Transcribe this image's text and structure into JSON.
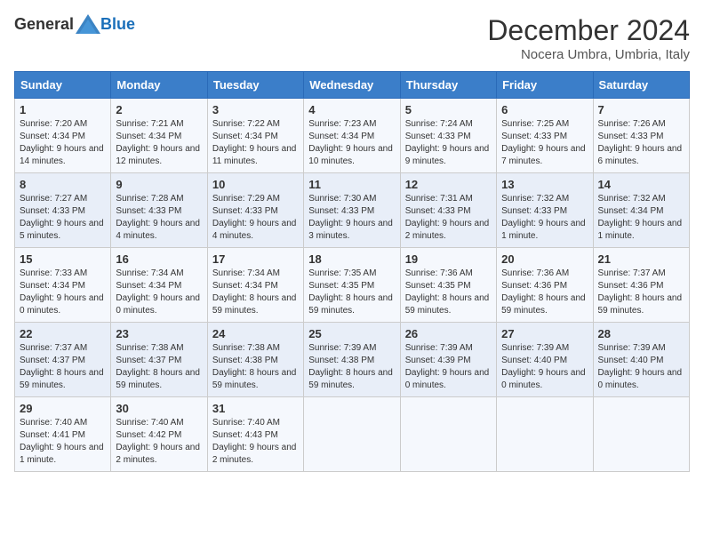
{
  "header": {
    "logo_general": "General",
    "logo_blue": "Blue",
    "month_title": "December 2024",
    "subtitle": "Nocera Umbra, Umbria, Italy"
  },
  "days_of_week": [
    "Sunday",
    "Monday",
    "Tuesday",
    "Wednesday",
    "Thursday",
    "Friday",
    "Saturday"
  ],
  "weeks": [
    [
      {
        "day": "1",
        "sunrise": "7:20 AM",
        "sunset": "4:34 PM",
        "daylight": "9 hours and 14 minutes."
      },
      {
        "day": "2",
        "sunrise": "7:21 AM",
        "sunset": "4:34 PM",
        "daylight": "9 hours and 12 minutes."
      },
      {
        "day": "3",
        "sunrise": "7:22 AM",
        "sunset": "4:34 PM",
        "daylight": "9 hours and 11 minutes."
      },
      {
        "day": "4",
        "sunrise": "7:23 AM",
        "sunset": "4:34 PM",
        "daylight": "9 hours and 10 minutes."
      },
      {
        "day": "5",
        "sunrise": "7:24 AM",
        "sunset": "4:33 PM",
        "daylight": "9 hours and 9 minutes."
      },
      {
        "day": "6",
        "sunrise": "7:25 AM",
        "sunset": "4:33 PM",
        "daylight": "9 hours and 7 minutes."
      },
      {
        "day": "7",
        "sunrise": "7:26 AM",
        "sunset": "4:33 PM",
        "daylight": "9 hours and 6 minutes."
      }
    ],
    [
      {
        "day": "8",
        "sunrise": "7:27 AM",
        "sunset": "4:33 PM",
        "daylight": "9 hours and 5 minutes."
      },
      {
        "day": "9",
        "sunrise": "7:28 AM",
        "sunset": "4:33 PM",
        "daylight": "9 hours and 4 minutes."
      },
      {
        "day": "10",
        "sunrise": "7:29 AM",
        "sunset": "4:33 PM",
        "daylight": "9 hours and 4 minutes."
      },
      {
        "day": "11",
        "sunrise": "7:30 AM",
        "sunset": "4:33 PM",
        "daylight": "9 hours and 3 minutes."
      },
      {
        "day": "12",
        "sunrise": "7:31 AM",
        "sunset": "4:33 PM",
        "daylight": "9 hours and 2 minutes."
      },
      {
        "day": "13",
        "sunrise": "7:32 AM",
        "sunset": "4:33 PM",
        "daylight": "9 hours and 1 minute."
      },
      {
        "day": "14",
        "sunrise": "7:32 AM",
        "sunset": "4:34 PM",
        "daylight": "9 hours and 1 minute."
      }
    ],
    [
      {
        "day": "15",
        "sunrise": "7:33 AM",
        "sunset": "4:34 PM",
        "daylight": "9 hours and 0 minutes."
      },
      {
        "day": "16",
        "sunrise": "7:34 AM",
        "sunset": "4:34 PM",
        "daylight": "9 hours and 0 minutes."
      },
      {
        "day": "17",
        "sunrise": "7:34 AM",
        "sunset": "4:34 PM",
        "daylight": "8 hours and 59 minutes."
      },
      {
        "day": "18",
        "sunrise": "7:35 AM",
        "sunset": "4:35 PM",
        "daylight": "8 hours and 59 minutes."
      },
      {
        "day": "19",
        "sunrise": "7:36 AM",
        "sunset": "4:35 PM",
        "daylight": "8 hours and 59 minutes."
      },
      {
        "day": "20",
        "sunrise": "7:36 AM",
        "sunset": "4:36 PM",
        "daylight": "8 hours and 59 minutes."
      },
      {
        "day": "21",
        "sunrise": "7:37 AM",
        "sunset": "4:36 PM",
        "daylight": "8 hours and 59 minutes."
      }
    ],
    [
      {
        "day": "22",
        "sunrise": "7:37 AM",
        "sunset": "4:37 PM",
        "daylight": "8 hours and 59 minutes."
      },
      {
        "day": "23",
        "sunrise": "7:38 AM",
        "sunset": "4:37 PM",
        "daylight": "8 hours and 59 minutes."
      },
      {
        "day": "24",
        "sunrise": "7:38 AM",
        "sunset": "4:38 PM",
        "daylight": "8 hours and 59 minutes."
      },
      {
        "day": "25",
        "sunrise": "7:39 AM",
        "sunset": "4:38 PM",
        "daylight": "8 hours and 59 minutes."
      },
      {
        "day": "26",
        "sunrise": "7:39 AM",
        "sunset": "4:39 PM",
        "daylight": "9 hours and 0 minutes."
      },
      {
        "day": "27",
        "sunrise": "7:39 AM",
        "sunset": "4:40 PM",
        "daylight": "9 hours and 0 minutes."
      },
      {
        "day": "28",
        "sunrise": "7:39 AM",
        "sunset": "4:40 PM",
        "daylight": "9 hours and 0 minutes."
      }
    ],
    [
      {
        "day": "29",
        "sunrise": "7:40 AM",
        "sunset": "4:41 PM",
        "daylight": "9 hours and 1 minute."
      },
      {
        "day": "30",
        "sunrise": "7:40 AM",
        "sunset": "4:42 PM",
        "daylight": "9 hours and 2 minutes."
      },
      {
        "day": "31",
        "sunrise": "7:40 AM",
        "sunset": "4:43 PM",
        "daylight": "9 hours and 2 minutes."
      },
      null,
      null,
      null,
      null
    ]
  ],
  "labels": {
    "sunrise": "Sunrise:",
    "sunset": "Sunset:",
    "daylight": "Daylight:"
  }
}
